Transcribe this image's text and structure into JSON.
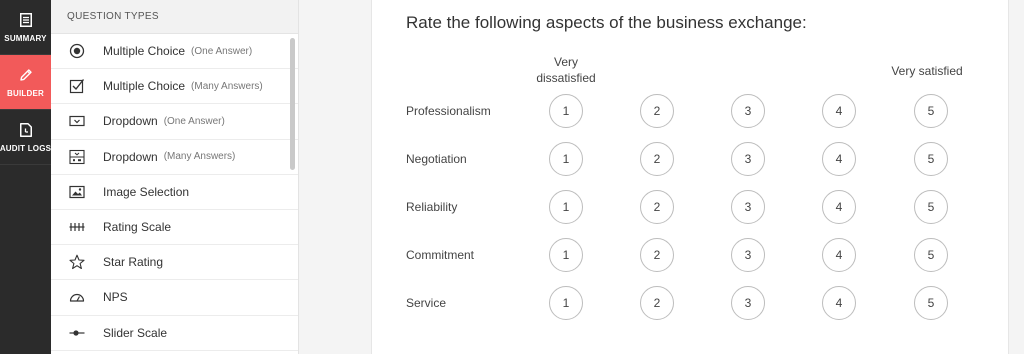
{
  "nav": {
    "items": [
      {
        "label": "SUMMARY",
        "icon": "summary-icon"
      },
      {
        "label": "BUILDER",
        "icon": "pencil-icon",
        "active": true
      },
      {
        "label": "AUDIT LOGS",
        "icon": "audit-logs-icon"
      }
    ],
    "active_color": "#f25a5a"
  },
  "question_types": {
    "header": "QUESTION TYPES",
    "items": [
      {
        "label": "Multiple Choice",
        "sub": "(One Answer)",
        "icon": "radio-icon"
      },
      {
        "label": "Multiple Choice",
        "sub": "(Many Answers)",
        "icon": "checkbox-icon"
      },
      {
        "label": "Dropdown",
        "sub": "(One Answer)",
        "icon": "dropdown-icon"
      },
      {
        "label": "Dropdown",
        "sub": "(Many Answers)",
        "icon": "dropdown-multi-icon"
      },
      {
        "label": "Image Selection",
        "sub": "",
        "icon": "image-icon"
      },
      {
        "label": "Rating Scale",
        "sub": "",
        "icon": "rating-scale-icon"
      },
      {
        "label": "Star Rating",
        "sub": "",
        "icon": "star-icon"
      },
      {
        "label": "NPS",
        "sub": "",
        "icon": "gauge-icon"
      },
      {
        "label": "Slider Scale",
        "sub": "",
        "icon": "slider-icon"
      }
    ]
  },
  "survey": {
    "question": "Rate the following aspects of the business exchange:",
    "scale_low_label": "Very\ndissatisfied",
    "scale_high_label": "Very satisfied",
    "options": [
      "1",
      "2",
      "3",
      "4",
      "5"
    ],
    "rows": [
      "Professionalism",
      "Negotiation",
      "Reliability",
      "Commitment",
      "Service"
    ]
  }
}
